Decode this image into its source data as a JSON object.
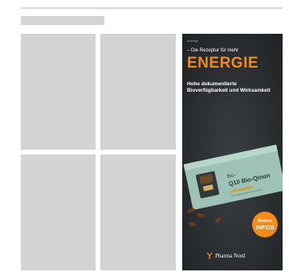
{
  "ad": {
    "tag": "Anzeige",
    "tagline": "– Die Rezeptur für mehr",
    "headline": "ENERGIE",
    "claim": "Hohe dokumentierte Bioverfügbarkeit und Wirksamkeit",
    "product_name_line1": "Bio-",
    "product_name_line2": "Q10 Bio-Qinon",
    "cta_line1": "Weitere",
    "cta_line2": "INFOS",
    "brand": "Pharma Nord",
    "colors": {
      "accent": "#f28a1c",
      "background": "#2b2f32",
      "pack": "#a9c9bd"
    }
  }
}
